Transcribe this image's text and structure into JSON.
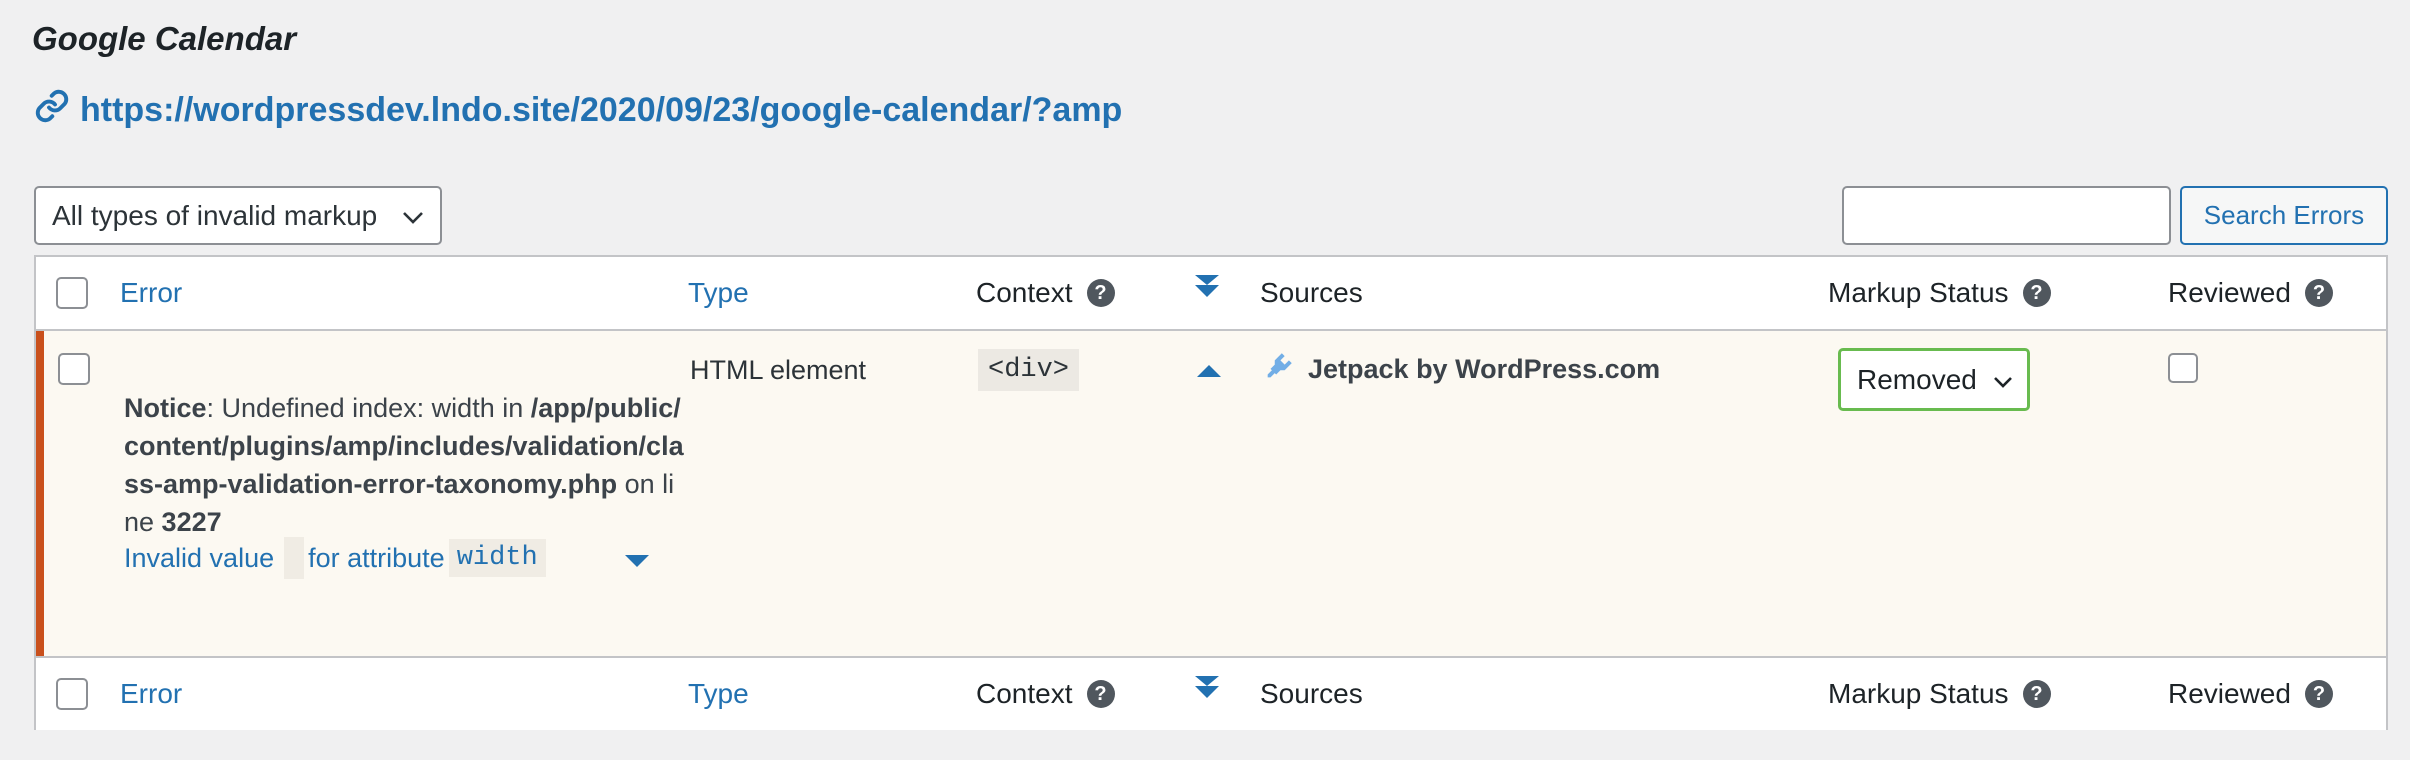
{
  "page": {
    "title": "Google Calendar",
    "url": "https://wordpressdev.lndo.site/2020/09/23/google-calendar/?amp"
  },
  "toolbar": {
    "filter_label": "All types of invalid markup",
    "search_value": "",
    "search_button": "Search Errors"
  },
  "columns": {
    "error": "Error",
    "type": "Type",
    "context": "Context",
    "sources": "Sources",
    "markup_status": "Markup Status",
    "reviewed": "Reviewed",
    "help_symbol": "?"
  },
  "row": {
    "notice_label": "Notice",
    "notice_msg": ": Undefined index: width in",
    "file_path": "/app/public/content/plugins/amp/includes/validation/class-amp-validation-error-taxonomy.php",
    "on_line": " on line ",
    "line_number": "3227",
    "invalid_value_label": "Invalid value",
    "for_attribute_label": "for attribute",
    "attribute_name": "width",
    "type_value": "HTML element",
    "context_value": "<div>",
    "source_name": "Jetpack by WordPress.com",
    "markup_status_value": "Removed",
    "error_color": "#c9501c",
    "status_border_color": "#68bb4f"
  }
}
